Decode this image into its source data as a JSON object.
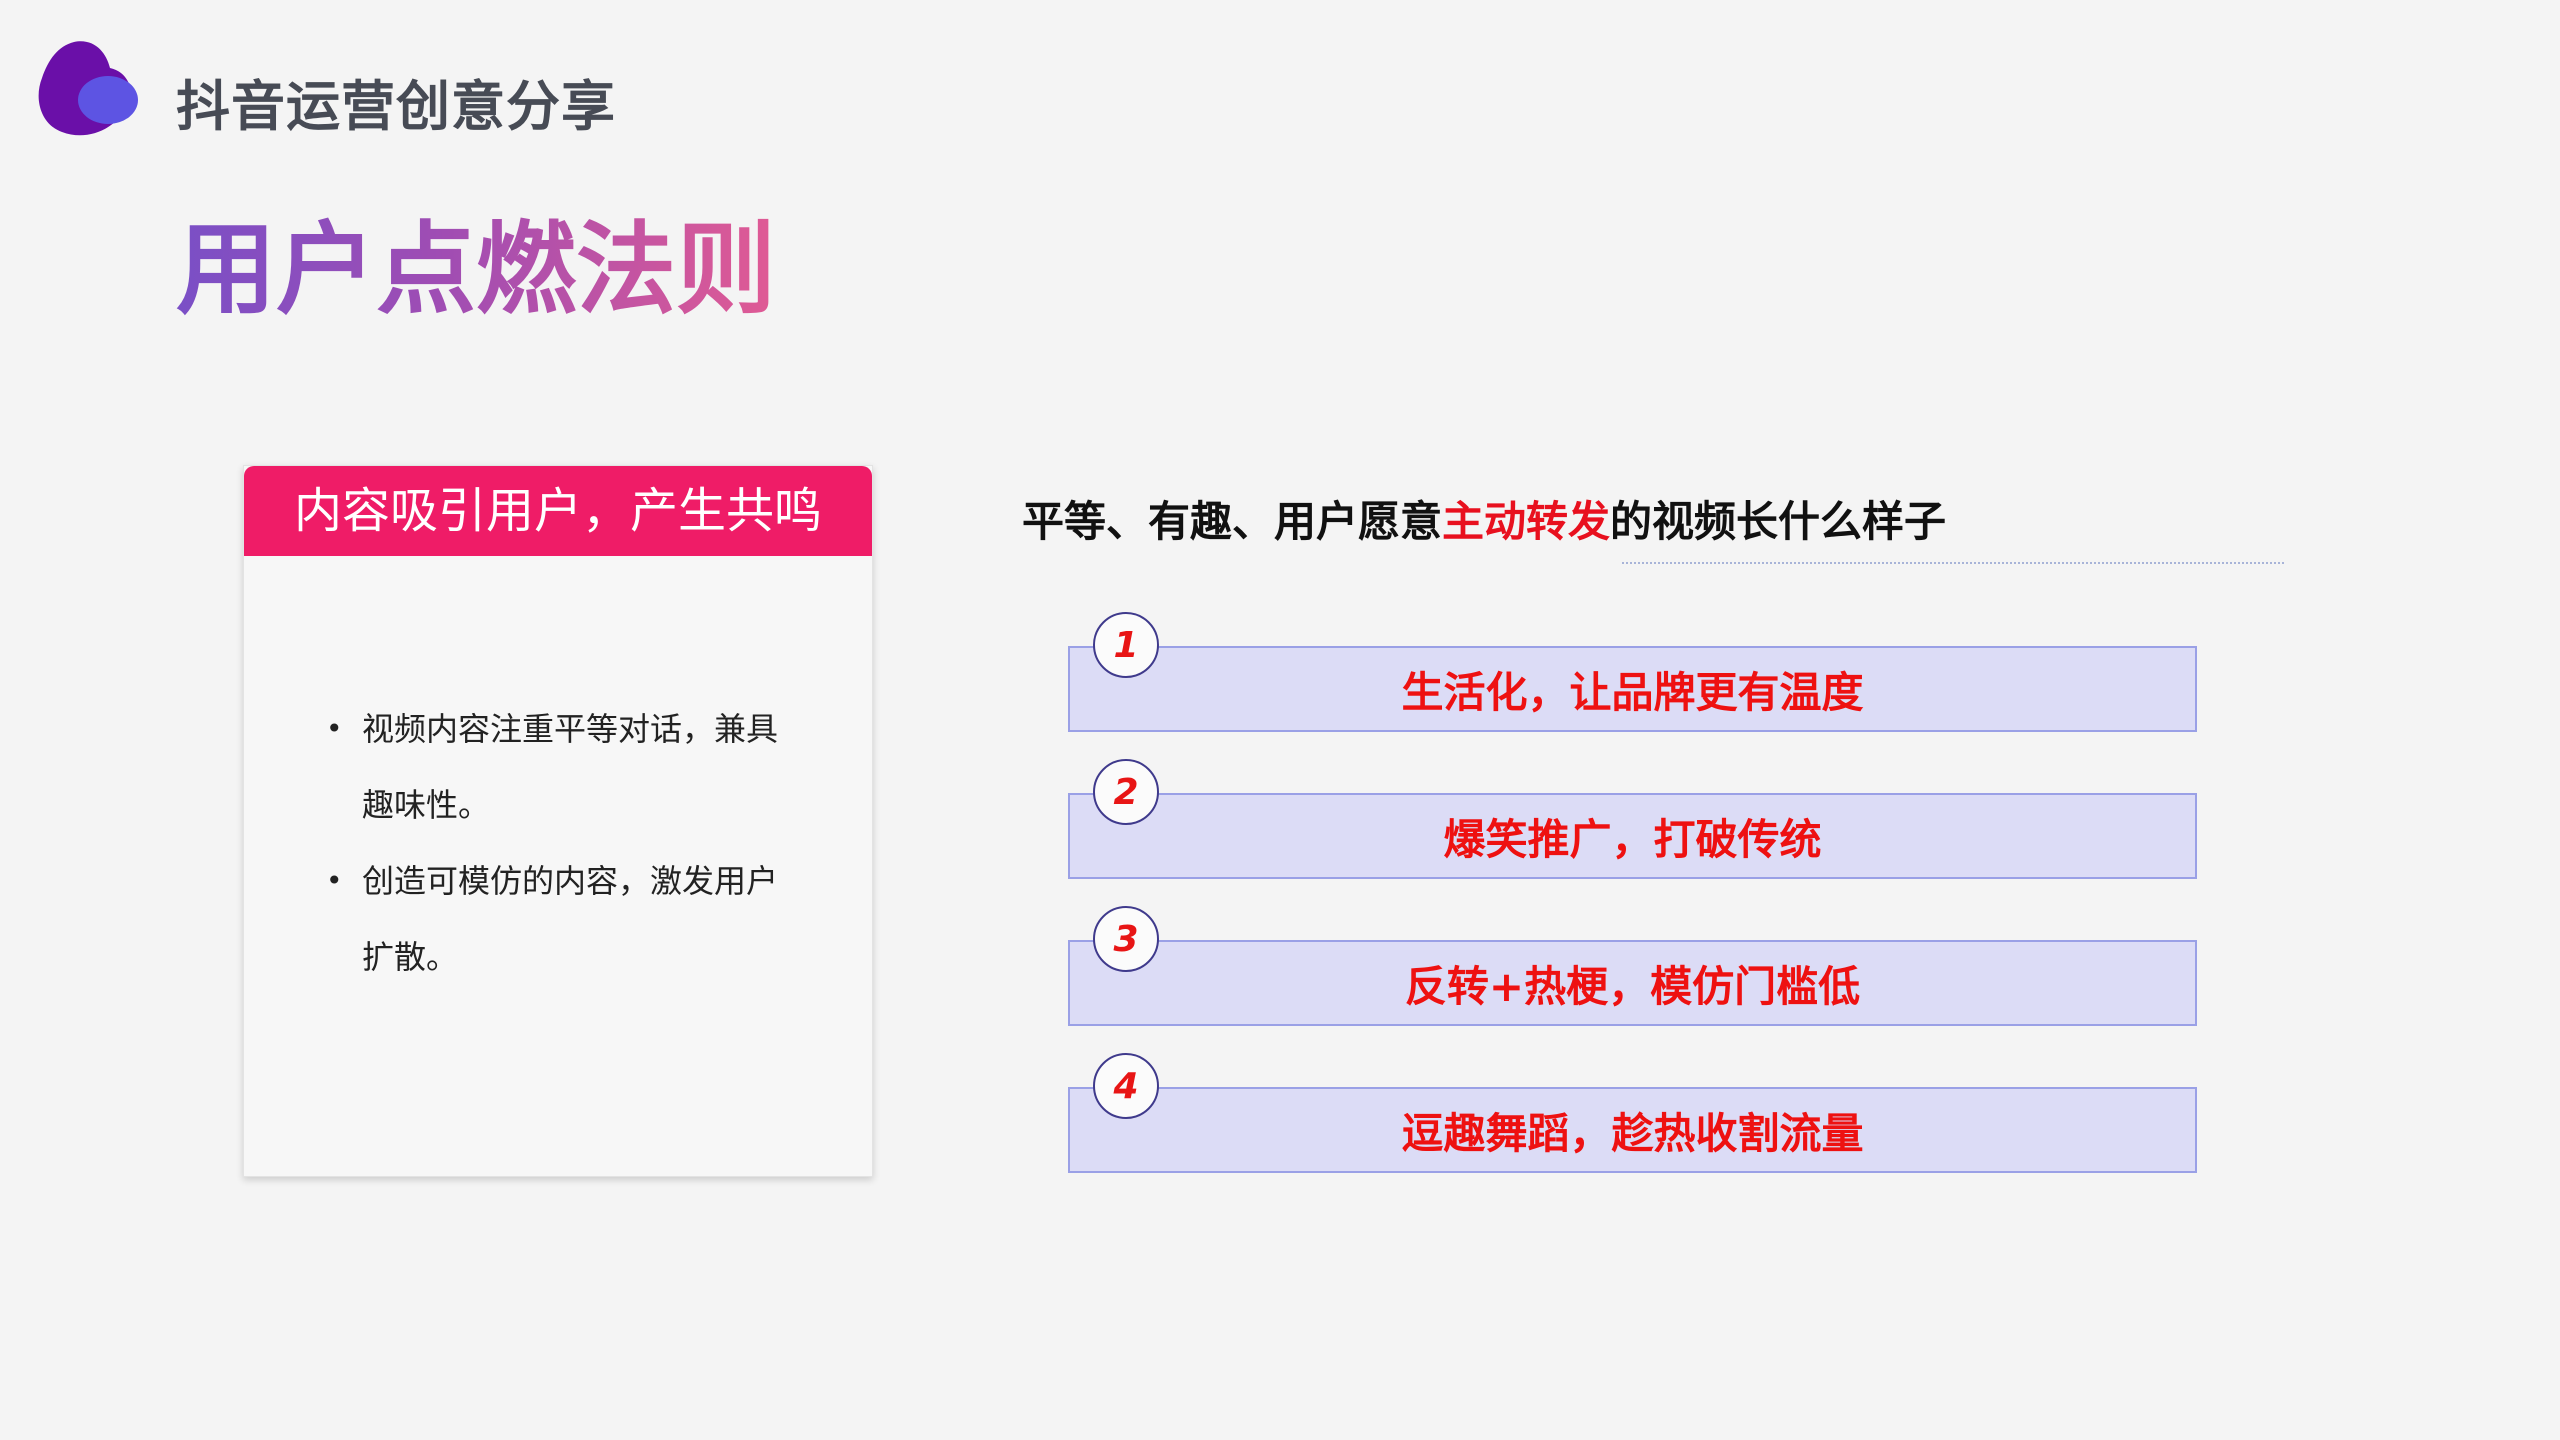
{
  "header": {
    "brand": "抖音运营创意分享",
    "logo_colors": [
      "#6a0fa8",
      "#5d54e3"
    ]
  },
  "title": "用户点燃法则",
  "card": {
    "header": "内容吸引用户，产生共鸣",
    "header_color": "#ef1c67",
    "bullets": [
      {
        "line1": "视频内容注重平等对话，兼具",
        "line2": "趣味性。"
      },
      {
        "line1": "创造可模仿的内容，激发用户",
        "line2": "扩散。"
      }
    ]
  },
  "subtitle": {
    "before": "平等、有趣、用户愿意",
    "highlight": "主动转发",
    "after": "的视频长什么样子"
  },
  "items": [
    {
      "num": "1",
      "label": "生活化，让品牌更有温度"
    },
    {
      "num": "2",
      "label": "爆笑推广，打破传统"
    },
    {
      "num": "3",
      "label": "反转+热梗，模仿门槛低"
    },
    {
      "num": "4",
      "label": "逗趣舞蹈，趁热收割流量"
    }
  ],
  "colors": {
    "accent": "#ef1c67",
    "highlight_text": "#e8101e",
    "item_bg": "#dcdcf6",
    "item_border": "#9aa0e6"
  }
}
